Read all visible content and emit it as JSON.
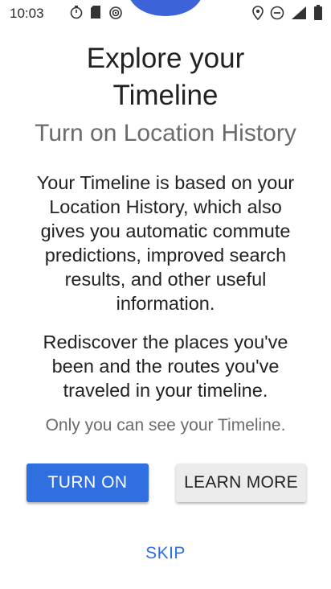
{
  "status_bar": {
    "time": "10:03",
    "icons_left": [
      "timer-icon",
      "sd-card-icon",
      "hotspot-icon"
    ],
    "icons_right": [
      "location-pin-icon",
      "do-not-disturb-icon",
      "signal-icon",
      "battery-icon"
    ]
  },
  "content": {
    "title_line1": "Explore your",
    "title_line2": "Timeline",
    "subtitle": "Turn on Location History",
    "paragraph1_lines": [
      "Your Timeline is based on your",
      "Location History, which also",
      "gives you automatic commute",
      "predictions, improved search",
      "results, and other useful",
      "information."
    ],
    "paragraph2_lines": [
      "Rediscover the places you've",
      "been and the routes you've",
      "traveled in your timeline."
    ],
    "privacy_note": "Only you can see your Timeline."
  },
  "actions": {
    "turn_on_label": "TURN ON",
    "learn_more_label": "LEARN MORE",
    "skip_label": "SKIP"
  },
  "colors": {
    "accent": "#2f6fe0",
    "top_blob": "#3d63d9",
    "secondary_text": "#6b6b6b",
    "primary_text": "#222222",
    "secondary_button": "#ececec"
  }
}
